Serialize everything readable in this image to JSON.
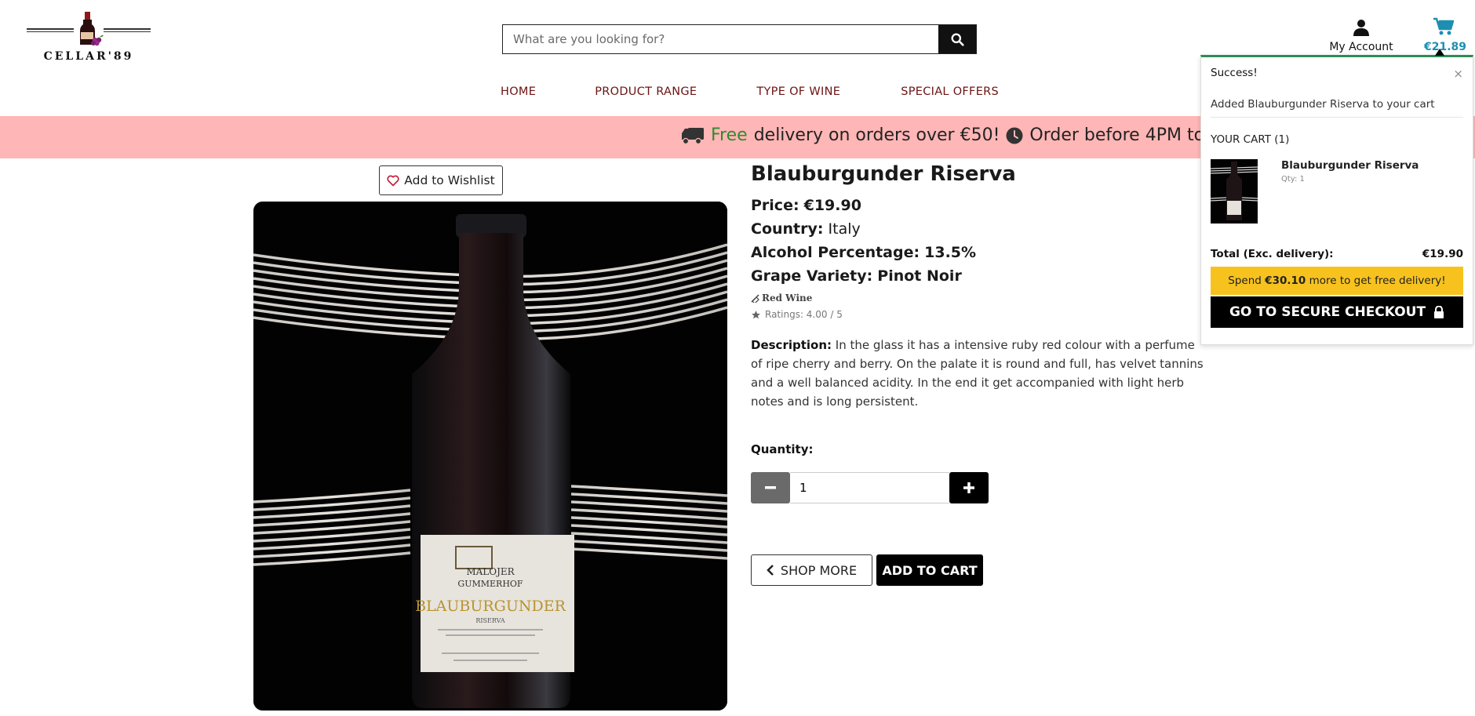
{
  "header": {
    "logo_text": "CELLAR'89",
    "search_placeholder": "What are you looking for?",
    "nav": [
      "HOME",
      "PRODUCT RANGE",
      "TYPE OF WINE",
      "SPECIAL OFFERS"
    ],
    "account_label": "My Account",
    "cart_amount": "€21.89"
  },
  "promo": {
    "free": "Free",
    "text1": "delivery on orders over €50!",
    "text2": "Order before 4PM to"
  },
  "product": {
    "wishlist_label": "Add to Wishlist",
    "title": "Blauburgunder Riserva",
    "price_label": "Price:",
    "price": "€19.90",
    "country_label": "Country:",
    "country": "Italy",
    "alcohol_label": "Alcohol Percentage:",
    "alcohol": "13.5%",
    "grape_label": "Grape Variety:",
    "grape": "Pinot Noir",
    "tag": "Red Wine",
    "rating": "Ratings: 4.00 / 5",
    "desc_label": "Description:",
    "description": "In the glass it has a intensive ruby red colour with a perfume of ripe cherry and berry. On the palate it is round and full, has velvet tannins and a well balanced acidity. In the end it get accompanied with light herb notes and is long persistent.",
    "quantity_label": "Quantity:",
    "quantity": "1",
    "shop_more": "SHOP MORE",
    "add_to_cart": "ADD TO CART",
    "label_lines": [
      "MALOJER",
      "GUMMERHOF",
      "BLAUBURGUNDER",
      "RISERVA"
    ]
  },
  "popup": {
    "title": "Success!",
    "close": "×",
    "message": "Added Blauburgunder Riserva to your cart",
    "your_cart": "YOUR CART (1)",
    "item_name": "Blauburgunder Riserva",
    "item_qty": "Qty: 1",
    "total_label": "Total (Exc. delivery):",
    "total": "€19.90",
    "spend_pre": "Spend",
    "spend_amount": "€30.10",
    "spend_post": "more to get free delivery!",
    "checkout": "GO TO SECURE CHECKOUT"
  },
  "colors": {
    "nav": "#6d1313",
    "promo_bg": "#ffb6b6",
    "free": "#2e8b2e",
    "cart_accent": "#1d8fb1",
    "spend_bg": "#f7c21e"
  }
}
